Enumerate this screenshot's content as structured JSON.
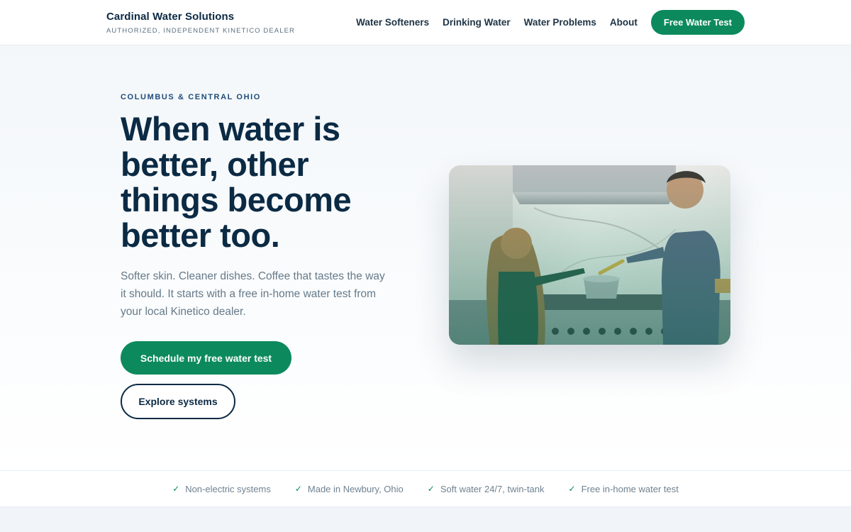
{
  "header": {
    "brand_name": "Cardinal Water Solutions",
    "brand_tagline": "AUTHORIZED, INDEPENDENT KINETICO DEALER",
    "nav": [
      {
        "label": "Water Softeners"
      },
      {
        "label": "Drinking Water"
      },
      {
        "label": "Water Problems"
      },
      {
        "label": "About"
      }
    ],
    "cta_label": "Free Water Test"
  },
  "hero": {
    "eyebrow": "COLUMBUS & CENTRAL OHIO",
    "headline": "When water is better, other things become better too.",
    "lede": "Softer skin. Cleaner dishes. Coffee that tastes the way it should. It starts with a free in-home water test from your local Kinetico dealer.",
    "primary_button": "Schedule my free water test",
    "secondary_button": "Explore systems",
    "image_icon": "kitchen-photo"
  },
  "trust": {
    "check_glyph": "✓",
    "items": [
      {
        "label": "Non-electric systems"
      },
      {
        "label": "Made in Newbury, Ohio"
      },
      {
        "label": "Soft water 24/7, twin-tank"
      },
      {
        "label": "Free in-home water test"
      }
    ]
  },
  "colors": {
    "brand_green": "#0c8a5e",
    "navy": "#0b2a44",
    "eyebrow_blue": "#1f4b7a"
  }
}
